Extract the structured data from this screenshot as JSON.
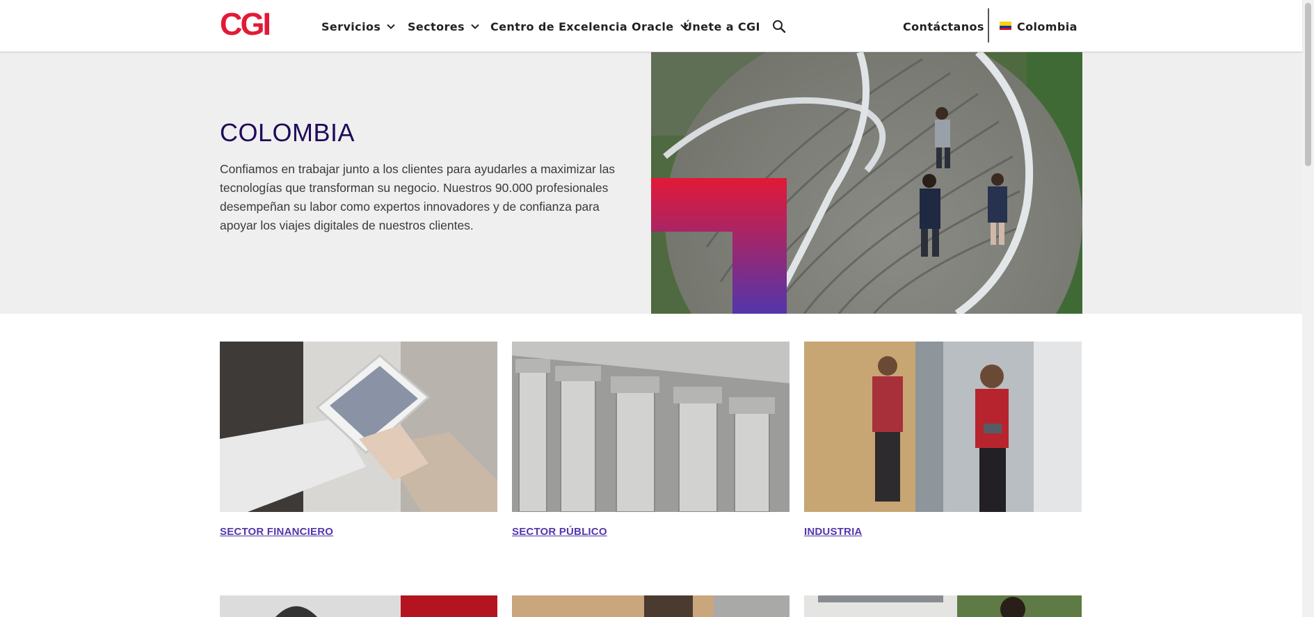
{
  "header": {
    "logo_text": "CGI",
    "nav": [
      {
        "label": "Servicios",
        "has_dropdown": true
      },
      {
        "label": "Sectores",
        "has_dropdown": true
      },
      {
        "label": "Centro de Excelencia Oracle",
        "has_dropdown": true
      },
      {
        "label": "Únete a CGI",
        "has_dropdown": false
      }
    ],
    "contact_label": "Contáctanos",
    "country_label": "Colombia",
    "icons": {
      "search": "search-icon",
      "chevron": "chevron-down-icon",
      "flag": "colombia-flag-icon"
    }
  },
  "hero": {
    "title": "COLOMBIA",
    "text": "Confiamos en trabajar junto a los clientes para ayudarles a maximizar las tecnologías que transforman su negocio. Nuestros 90.000 profesionales desempeñan su labor como expertos innovadores y de confianza para apoyar los viajes digitales de nuestros clientes."
  },
  "cards": [
    {
      "label": "SECTOR FINANCIERO"
    },
    {
      "label": "SECTOR PÚBLICO"
    },
    {
      "label": "INDUSTRIA"
    }
  ],
  "colors": {
    "brand_red": "#e31937",
    "brand_purple": "#5236ab",
    "title_navy": "#200a5a",
    "hero_bg": "#efefef"
  }
}
